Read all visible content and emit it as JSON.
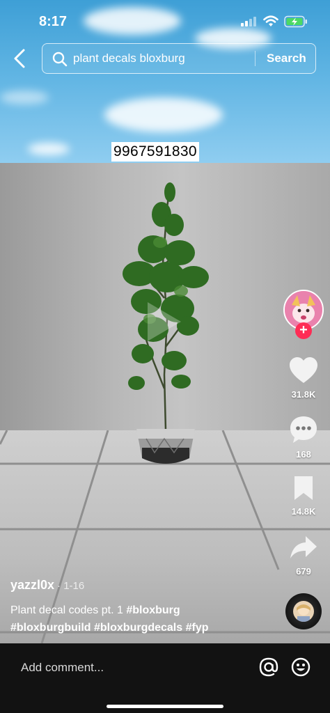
{
  "status_bar": {
    "time": "8:17"
  },
  "search": {
    "query": "plant decals bloxburg",
    "button_label": "Search"
  },
  "video": {
    "decal_code": "9967591830"
  },
  "actions": {
    "likes": "31.8K",
    "comments": "168",
    "saves": "14.8K",
    "shares": "679"
  },
  "post": {
    "author": "yazzl0x",
    "date": "· 1-16",
    "caption_text": "Plant decal codes pt. 1",
    "hashtags": [
      "#bloxburg",
      "#bloxburgbuild",
      "#bloxburgdecals",
      "#fyp"
    ]
  },
  "comment_bar": {
    "placeholder": "Add comment..."
  },
  "colors": {
    "accent": "#fe2c55",
    "battery": "#4cd964"
  },
  "icons": [
    "back-icon",
    "search-icon",
    "heart-icon",
    "comment-icon",
    "bookmark-icon",
    "share-icon",
    "at-icon",
    "emoji-icon",
    "play-icon"
  ]
}
